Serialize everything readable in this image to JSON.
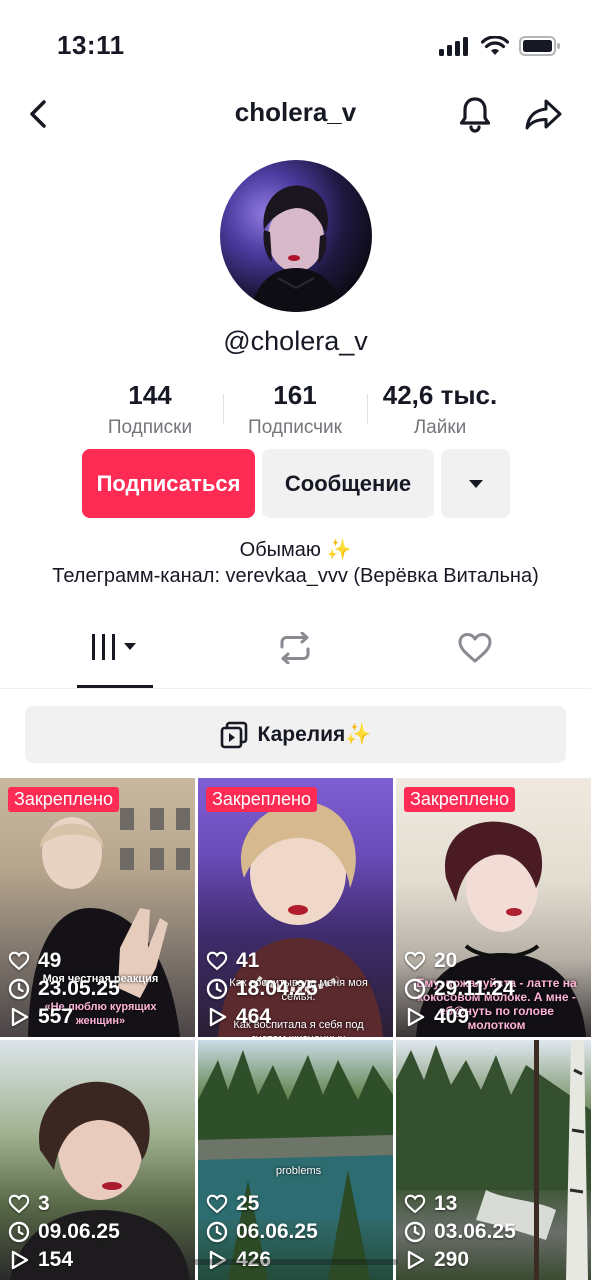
{
  "status_bar": {
    "time": "13:11"
  },
  "header": {
    "title": "cholera_v"
  },
  "profile": {
    "handle": "@cholera_v"
  },
  "stats": [
    {
      "value": "144",
      "label": "Подписки"
    },
    {
      "value": "161",
      "label": "Подписчик"
    },
    {
      "value": "42,6 тыс.",
      "label": "Лайки"
    }
  ],
  "actions": {
    "follow": "Подписаться",
    "message": "Сообщение"
  },
  "bio": {
    "line1": "Обымаю ✨",
    "line2": "Телеграмм-канал: verevkaa_vvv (Верёвка Витальна)"
  },
  "playlist": {
    "title": "Карелия✨"
  },
  "videos": [
    {
      "pinned": "Закреплено",
      "likes": "49",
      "date": "23.05.25",
      "views": "557",
      "caption1": "Моя честная реакция",
      "caption2": "«Не люблю курящих женщин»"
    },
    {
      "pinned": "Закреплено",
      "likes": "41",
      "date": "18.04.25",
      "views": "464",
      "caption1": "Как воспитывала меня моя семья:",
      "caption2": "Как воспитала я себя под гнетом жизненных обстоятельств:"
    },
    {
      "pinned": "Закреплено",
      "likes": "20",
      "date": "29.11.24",
      "views": "409",
      "caption1": "Ему, пожалуйста - латте на кокосовом молоке. А мне - еб@нуть по голове молотком",
      "caption2": ""
    },
    {
      "likes": "3",
      "date": "09.06.25",
      "views": "154"
    },
    {
      "likes": "25",
      "date": "06.06.25",
      "views": "426",
      "caption1": "problems"
    },
    {
      "likes": "13",
      "date": "03.06.25",
      "views": "290"
    }
  ],
  "colors": {
    "accent": "#fe2c55",
    "text": "#161823",
    "muted": "#75767b",
    "button_bg": "#f1f1f2"
  },
  "icons": [
    "back-icon",
    "bell-icon",
    "share-icon",
    "dropdown-icon",
    "videos-grid-icon",
    "repost-icon",
    "heart-icon",
    "playlist-icon",
    "clock-icon",
    "play-icon"
  ]
}
